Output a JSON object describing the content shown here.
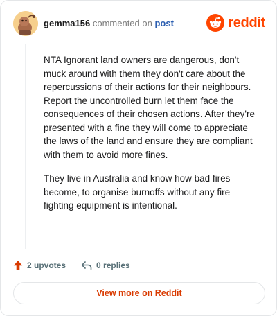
{
  "comment": {
    "username": "gemma156",
    "action_text": "commented on",
    "post_link": "post",
    "paragraphs": [
      "NTA Ignorant land owners are dangerous, don't muck around with them they don't care about the repercussions of their actions for their neighbours. Report the uncontrolled burn let them face the consequences of their chosen actions. After they're presented with a fine they will come to appreciate the laws of the land and ensure they are compliant with them to avoid more fines.",
      "They live in Australia and know how bad fires become, to organise burnoffs without any fire fighting equipment is intentional."
    ]
  },
  "brand": {
    "name": "reddit",
    "color": "#ff4500"
  },
  "actions": {
    "upvotes_label": "2 upvotes",
    "replies_label": "0 replies"
  },
  "footer": {
    "view_more_label": "View more on Reddit"
  },
  "colors": {
    "accent": "#ff4500",
    "link": "#2a5db0",
    "view_more_text": "#d93a00"
  }
}
